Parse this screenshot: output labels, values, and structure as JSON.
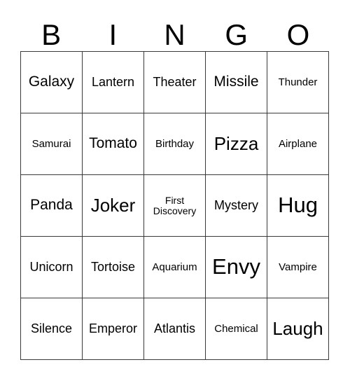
{
  "card": {
    "header": {
      "letters": [
        "B",
        "I",
        "N",
        "G",
        "O"
      ]
    },
    "grid": {
      "columns": 5,
      "rows": 5,
      "line_color": "#3a3a3a",
      "background_color": "#ffffff",
      "text_color": "#000000"
    },
    "cells": [
      [
        {
          "text": "Galaxy",
          "size": "md"
        },
        {
          "text": "Lantern",
          "size": "sm"
        },
        {
          "text": "Theater",
          "size": "sm"
        },
        {
          "text": "Missile",
          "size": "md"
        },
        {
          "text": "Thunder",
          "size": "xs"
        }
      ],
      [
        {
          "text": "Samurai",
          "size": "xs"
        },
        {
          "text": "Tomato",
          "size": "md"
        },
        {
          "text": "Birthday",
          "size": "xs"
        },
        {
          "text": "Pizza",
          "size": "lg"
        },
        {
          "text": "Airplane",
          "size": "xs"
        }
      ],
      [
        {
          "text": "Panda",
          "size": "md"
        },
        {
          "text": "Joker",
          "size": "lg"
        },
        {
          "text": "First\nDiscovery",
          "size": "xxs"
        },
        {
          "text": "Mystery",
          "size": "sm"
        },
        {
          "text": "Hug",
          "size": "xl"
        }
      ],
      [
        {
          "text": "Unicorn",
          "size": "sm"
        },
        {
          "text": "Tortoise",
          "size": "sm"
        },
        {
          "text": "Aquarium",
          "size": "xs"
        },
        {
          "text": "Envy",
          "size": "xl"
        },
        {
          "text": "Vampire",
          "size": "xs"
        }
      ],
      [
        {
          "text": "Silence",
          "size": "sm"
        },
        {
          "text": "Emperor",
          "size": "sm"
        },
        {
          "text": "Atlantis",
          "size": "sm"
        },
        {
          "text": "Chemical",
          "size": "xs"
        },
        {
          "text": "Laugh",
          "size": "lg"
        }
      ]
    ]
  }
}
